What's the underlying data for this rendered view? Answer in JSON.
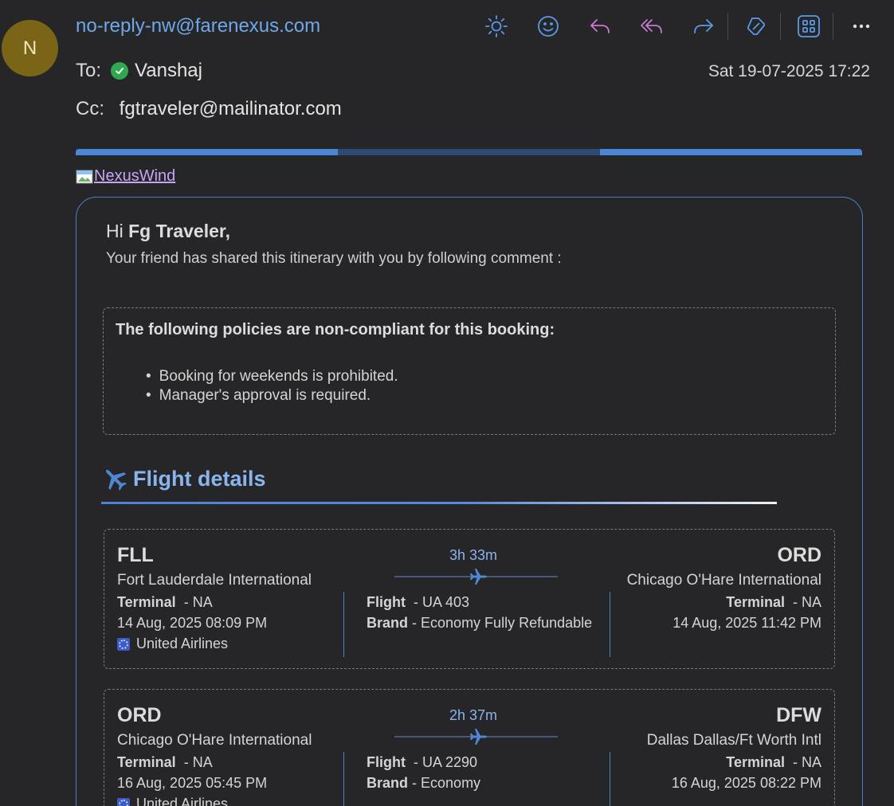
{
  "header": {
    "avatar_initial": "N",
    "sender": "no-reply-nw@farenexus.com",
    "to_label": "To:",
    "to_name": "Vanshaj",
    "cc_label": "Cc:",
    "cc_address": "fgtraveler@mailinator.com",
    "datetime": "Sat 19-07-2025 17:22"
  },
  "toolbar": {
    "icons": [
      "sun-icon",
      "emoji-icon",
      "reply-icon",
      "reply-all-icon",
      "forward-icon",
      "copilot-icon",
      "apps-icon",
      "more-icon"
    ]
  },
  "email": {
    "logo_alt": "NexusWind",
    "stripe_colors": [
      "#4a86d6",
      "#2c4a73",
      "#4a86d6"
    ],
    "greeting_prefix": "Hi",
    "greeting_name": "Fg Traveler,",
    "shared_text": "Your friend has shared this itinerary with you by following comment :",
    "policy": {
      "title": "The following policies are non-compliant for this booking:",
      "items": [
        "Booking for weekends is prohibited.",
        "Manager's approval is required."
      ]
    },
    "flight_details_title": "Flight details",
    "segments": [
      {
        "from_code": "FLL",
        "from_airport": "Fort Lauderdale International",
        "from_terminal_label": "Terminal",
        "from_terminal": "-  NA",
        "from_datetime": "14 Aug, 2025 08:09 PM",
        "airline": "United Airlines",
        "duration": "3h 33m",
        "flight_label": "Flight",
        "flight": "-  UA 403",
        "brand_label": "Brand",
        "brand": "- Economy Fully Refundable",
        "to_code": "ORD",
        "to_airport": "Chicago O'Hare International",
        "to_terminal_label": "Terminal",
        "to_terminal": "-  NA",
        "to_datetime": "14 Aug, 2025 11:42 PM"
      },
      {
        "from_code": "ORD",
        "from_airport": "Chicago O'Hare International",
        "from_terminal_label": "Terminal",
        "from_terminal": "-  NA",
        "from_datetime": "16 Aug, 2025 05:45 PM",
        "airline": "United Airlines",
        "duration": "2h 37m",
        "flight_label": "Flight",
        "flight": "-  UA 2290",
        "brand_label": "Brand",
        "brand": "- Economy",
        "to_code": "DFW",
        "to_airport": "Dallas Dallas/Ft Worth Intl",
        "to_terminal_label": "Terminal",
        "to_terminal": "-  NA",
        "to_datetime": "16 Aug, 2025 08:22 PM"
      }
    ]
  }
}
